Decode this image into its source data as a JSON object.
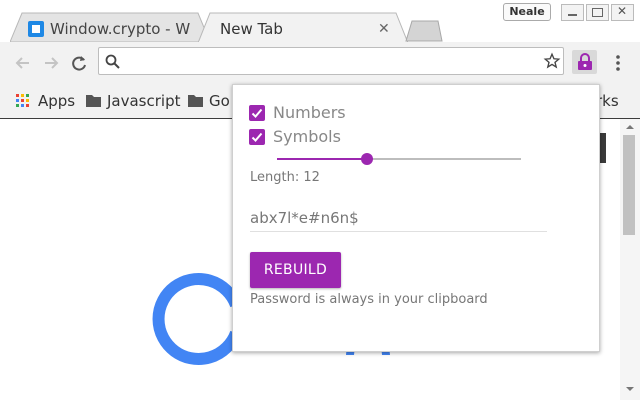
{
  "browser": {
    "tabs": [
      {
        "title": "Window.crypto - W",
        "active": false
      },
      {
        "title": "New Tab",
        "active": true
      }
    ],
    "profile_name": "Neale",
    "omnibox": {
      "value": "",
      "placeholder": ""
    },
    "bookmarks": [
      {
        "label": "Apps",
        "icon": "apps-grid-icon"
      },
      {
        "label": "Javascript",
        "icon": "folder-icon"
      },
      {
        "label": "Go",
        "icon": "folder-icon"
      },
      {
        "label": "rks",
        "icon": "folder-icon"
      }
    ]
  },
  "popup": {
    "options": [
      {
        "label": "Numbers",
        "checked": true
      },
      {
        "label": "Symbols",
        "checked": true
      }
    ],
    "slider": {
      "value_fraction": 0.37
    },
    "length_label": "Length: 12",
    "password": "abx7l*e#n6n$",
    "rebuild_label": "REBUILD",
    "note": "Password is always in your clipboard"
  },
  "colors": {
    "accent": "#9c27b0",
    "google_blue": "#4285f4"
  }
}
